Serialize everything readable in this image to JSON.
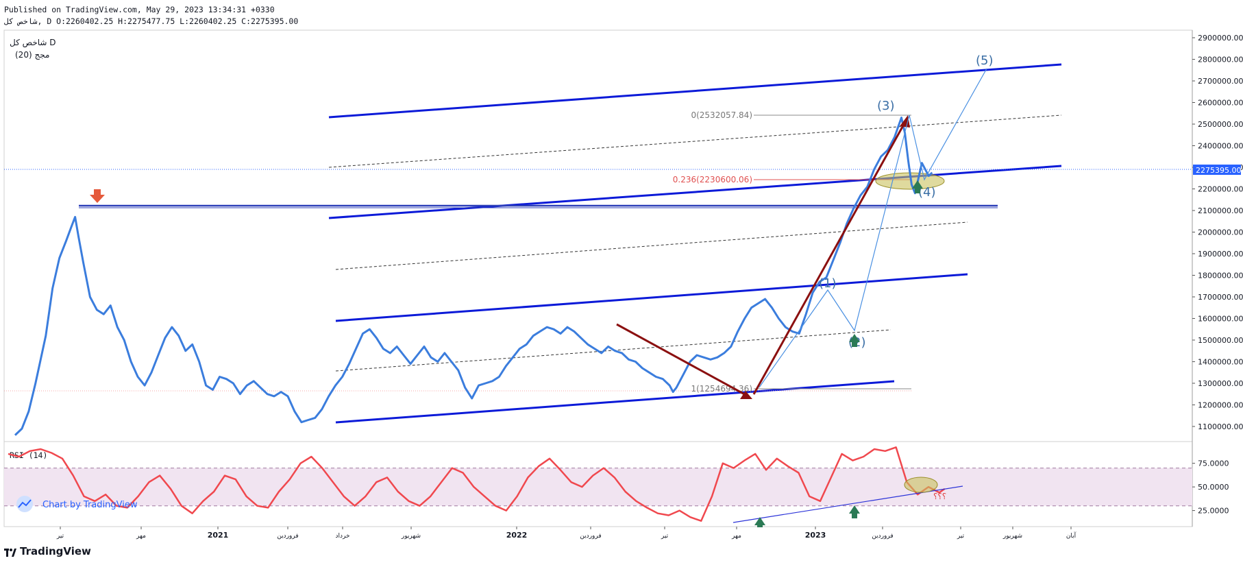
{
  "header": {
    "published": "Published on TradingView.com, May 29, 2023 13:34:31 +0330",
    "ohlc": "ﺷﺎﺧﺺ ﮐﻞ, D O:2260402.25 H:2275477.75 L:2260402.25 C:2275395.00"
  },
  "legend": {
    "symbol": "ﺷﺎﺧﺺ ﮐﻞ D",
    "ma": "(20) ﻣﺠﺞ"
  },
  "footer": {
    "brand": "TradingView",
    "watermark": "Chart by TradingView"
  },
  "colors": {
    "price": "#3b7ddd",
    "channel": "#0b1ad8",
    "rsi": "#f0484e",
    "rsi_band": "#f1e4f1",
    "trend_arrow": "#8b1010",
    "up_arrow": "#2b7a55",
    "down_arrow": "#e55a3c",
    "highlight": "#c9c15e",
    "last_price_tag": "#2962ff"
  },
  "chart_data": [
    {
      "type": "line",
      "title": "",
      "y_ticks": [
        1100000,
        1200000,
        1300000,
        1400000,
        1500000,
        1600000,
        1700000,
        1800000,
        1900000,
        2000000,
        2100000,
        2200000,
        2300000,
        2400000,
        2500000,
        2600000,
        2700000,
        2800000,
        2900000
      ],
      "y_tick_labels": [
        "1100000.00",
        "1200000.00",
        "1300000.00",
        "1400000.00",
        "1500000.00",
        "1600000.00",
        "1700000.00",
        "1800000.00",
        "1900000.00",
        "2000000.00",
        "2100000.00",
        "2200000.00",
        "2300000.00",
        "2400000.00",
        "2500000.00",
        "2600000.00",
        "2700000.00",
        "2800000.00",
        "2900000.00"
      ],
      "ylim": [
        1030000,
        2935000
      ],
      "x_axis_labels": [
        "تیر",
        "مهر",
        "2021",
        "فروردین",
        "خرداد",
        "شهریور",
        "2022",
        "فروردین",
        "تیر",
        "مهر",
        "2023",
        "فروردین",
        "تیر",
        "شهریور",
        "آبان"
      ],
      "last_price": 2275395,
      "last_price_label": "2275395.00",
      "series": [
        {
          "name": "",
          "points": [
            [
              0,
              1060000
            ],
            [
              0.01,
              1090000
            ],
            [
              0.02,
              1170000
            ],
            [
              0.03,
              1300000
            ],
            [
              0.045,
              1520000
            ],
            [
              0.055,
              1740000
            ],
            [
              0.065,
              1880000
            ],
            [
              0.075,
              1960000
            ],
            [
              0.082,
              2020000
            ],
            [
              0.088,
              2070000
            ],
            [
              0.093,
              1980000
            ],
            [
              0.1,
              1860000
            ],
            [
              0.11,
              1700000
            ],
            [
              0.12,
              1640000
            ],
            [
              0.13,
              1620000
            ],
            [
              0.14,
              1660000
            ],
            [
              0.15,
              1560000
            ],
            [
              0.16,
              1500000
            ],
            [
              0.17,
              1400000
            ],
            [
              0.18,
              1330000
            ],
            [
              0.19,
              1290000
            ],
            [
              0.2,
              1350000
            ],
            [
              0.21,
              1430000
            ],
            [
              0.22,
              1510000
            ],
            [
              0.23,
              1560000
            ],
            [
              0.24,
              1520000
            ],
            [
              0.25,
              1450000
            ],
            [
              0.26,
              1480000
            ],
            [
              0.27,
              1400000
            ],
            [
              0.28,
              1290000
            ],
            [
              0.29,
              1270000
            ],
            [
              0.3,
              1330000
            ],
            [
              0.31,
              1320000
            ],
            [
              0.32,
              1300000
            ],
            [
              0.33,
              1250000
            ],
            [
              0.34,
              1290000
            ],
            [
              0.35,
              1310000
            ],
            [
              0.36,
              1280000
            ],
            [
              0.37,
              1250000
            ],
            [
              0.38,
              1240000
            ],
            [
              0.39,
              1260000
            ],
            [
              0.4,
              1240000
            ],
            [
              0.41,
              1170000
            ],
            [
              0.42,
              1120000
            ],
            [
              0.43,
              1130000
            ],
            [
              0.44,
              1140000
            ],
            [
              0.45,
              1180000
            ],
            [
              0.46,
              1240000
            ],
            [
              0.47,
              1290000
            ],
            [
              0.48,
              1330000
            ],
            [
              0.49,
              1390000
            ],
            [
              0.5,
              1460000
            ],
            [
              0.51,
              1530000
            ],
            [
              0.52,
              1550000
            ],
            [
              0.53,
              1510000
            ],
            [
              0.54,
              1460000
            ],
            [
              0.55,
              1440000
            ],
            [
              0.56,
              1470000
            ],
            [
              0.57,
              1430000
            ],
            [
              0.58,
              1390000
            ],
            [
              0.59,
              1430000
            ],
            [
              0.6,
              1470000
            ],
            [
              0.61,
              1420000
            ],
            [
              0.62,
              1400000
            ],
            [
              0.63,
              1440000
            ],
            [
              0.64,
              1400000
            ],
            [
              0.65,
              1360000
            ],
            [
              0.66,
              1280000
            ],
            [
              0.67,
              1230000
            ],
            [
              0.68,
              1290000
            ],
            [
              0.69,
              1300000
            ],
            [
              0.7,
              1310000
            ],
            [
              0.71,
              1330000
            ],
            [
              0.72,
              1380000
            ],
            [
              0.73,
              1420000
            ],
            [
              0.74,
              1460000
            ],
            [
              0.75,
              1480000
            ],
            [
              0.76,
              1520000
            ],
            [
              0.77,
              1540000
            ],
            [
              0.78,
              1560000
            ],
            [
              0.79,
              1550000
            ],
            [
              0.8,
              1530000
            ],
            [
              0.81,
              1560000
            ],
            [
              0.82,
              1540000
            ],
            [
              0.83,
              1510000
            ],
            [
              0.84,
              1480000
            ],
            [
              0.85,
              1460000
            ],
            [
              0.86,
              1440000
            ],
            [
              0.87,
              1470000
            ],
            [
              0.88,
              1450000
            ],
            [
              0.89,
              1440000
            ],
            [
              0.9,
              1410000
            ],
            [
              0.91,
              1400000
            ],
            [
              0.92,
              1370000
            ],
            [
              0.93,
              1350000
            ],
            [
              0.94,
              1330000
            ],
            [
              0.95,
              1320000
            ],
            [
              0.96,
              1290000
            ],
            [
              0.965,
              1260000
            ],
            [
              0.97,
              1280000
            ],
            [
              0.98,
              1340000
            ],
            [
              0.99,
              1400000
            ],
            [
              1.0,
              1430000
            ],
            [
              1.01,
              1420000
            ],
            [
              1.02,
              1410000
            ],
            [
              1.03,
              1420000
            ],
            [
              1.04,
              1440000
            ],
            [
              1.05,
              1470000
            ],
            [
              1.06,
              1540000
            ],
            [
              1.07,
              1600000
            ],
            [
              1.08,
              1650000
            ],
            [
              1.09,
              1670000
            ],
            [
              1.1,
              1690000
            ],
            [
              1.11,
              1650000
            ],
            [
              1.12,
              1600000
            ],
            [
              1.13,
              1560000
            ],
            [
              1.14,
              1540000
            ],
            [
              1.15,
              1530000
            ],
            [
              1.16,
              1620000
            ],
            [
              1.17,
              1720000
            ],
            [
              1.18,
              1770000
            ],
            [
              1.19,
              1790000
            ],
            [
              1.2,
              1870000
            ],
            [
              1.21,
              1950000
            ],
            [
              1.22,
              2040000
            ],
            [
              1.23,
              2110000
            ],
            [
              1.24,
              2170000
            ],
            [
              1.25,
              2210000
            ],
            [
              1.26,
              2290000
            ],
            [
              1.27,
              2350000
            ],
            [
              1.28,
              2380000
            ],
            [
              1.29,
              2440000
            ],
            [
              1.3,
              2530000
            ],
            [
              1.305,
              2460000
            ],
            [
              1.31,
              2330000
            ],
            [
              1.315,
              2220000
            ],
            [
              1.32,
              2180000
            ],
            [
              1.325,
              2250000
            ],
            [
              1.33,
              2320000
            ],
            [
              1.335,
              2290000
            ],
            [
              1.34,
              2260000
            ],
            [
              1.345,
              2275395
            ]
          ]
        }
      ],
      "annotations": {
        "wave_labels": [
          "(1)",
          "(2)",
          "(3)",
          "(4)",
          "(5)"
        ],
        "fib_levels": [
          {
            "label": "0(2532057.84)",
            "value": 2532057.84
          },
          {
            "label": "0.236(2230600.06)",
            "value": 2230600.06
          },
          {
            "label": "1(1254694.36)",
            "value": 1254694.36
          }
        ]
      }
    },
    {
      "type": "line",
      "title": "RSI (14)",
      "y_ticks": [
        25,
        50,
        75
      ],
      "y_tick_labels": [
        "25.0000",
        "50.0000",
        "75.0000"
      ],
      "ylim": [
        8,
        98
      ],
      "band": [
        30,
        70
      ],
      "question_marks": "؟؟؟",
      "series": [
        {
          "name": "",
          "points": [
            [
              0.0,
              85
            ],
            [
              0.02,
              82
            ],
            [
              0.04,
              88
            ],
            [
              0.06,
              90
            ],
            [
              0.08,
              86
            ],
            [
              0.1,
              80
            ],
            [
              0.12,
              62
            ],
            [
              0.14,
              40
            ],
            [
              0.16,
              35
            ],
            [
              0.18,
              42
            ],
            [
              0.2,
              30
            ],
            [
              0.22,
              28
            ],
            [
              0.24,
              40
            ],
            [
              0.26,
              55
            ],
            [
              0.28,
              62
            ],
            [
              0.3,
              48
            ],
            [
              0.32,
              30
            ],
            [
              0.34,
              22
            ],
            [
              0.36,
              35
            ],
            [
              0.38,
              45
            ],
            [
              0.4,
              62
            ],
            [
              0.42,
              58
            ],
            [
              0.44,
              40
            ],
            [
              0.46,
              30
            ],
            [
              0.48,
              28
            ],
            [
              0.5,
              45
            ],
            [
              0.52,
              58
            ],
            [
              0.54,
              75
            ],
            [
              0.56,
              82
            ],
            [
              0.58,
              70
            ],
            [
              0.6,
              55
            ],
            [
              0.62,
              40
            ],
            [
              0.64,
              30
            ],
            [
              0.66,
              40
            ],
            [
              0.68,
              55
            ],
            [
              0.7,
              60
            ],
            [
              0.72,
              45
            ],
            [
              0.74,
              35
            ],
            [
              0.76,
              30
            ],
            [
              0.78,
              40
            ],
            [
              0.8,
              55
            ],
            [
              0.82,
              70
            ],
            [
              0.84,
              65
            ],
            [
              0.86,
              50
            ],
            [
              0.88,
              40
            ],
            [
              0.9,
              30
            ],
            [
              0.92,
              25
            ],
            [
              0.94,
              40
            ],
            [
              0.96,
              60
            ],
            [
              0.98,
              72
            ],
            [
              1.0,
              80
            ],
            [
              1.02,
              68
            ],
            [
              1.04,
              55
            ],
            [
              1.06,
              50
            ],
            [
              1.08,
              62
            ],
            [
              1.1,
              70
            ],
            [
              1.12,
              60
            ],
            [
              1.14,
              45
            ],
            [
              1.16,
              35
            ],
            [
              1.18,
              28
            ],
            [
              1.2,
              22
            ],
            [
              1.22,
              20
            ],
            [
              1.24,
              25
            ],
            [
              1.26,
              18
            ],
            [
              1.28,
              14
            ],
            [
              1.3,
              40
            ],
            [
              1.32,
              75
            ],
            [
              1.34,
              70
            ],
            [
              1.36,
              78
            ],
            [
              1.38,
              85
            ],
            [
              1.4,
              68
            ],
            [
              1.42,
              80
            ],
            [
              1.44,
              72
            ],
            [
              1.46,
              65
            ],
            [
              1.48,
              40
            ],
            [
              1.5,
              35
            ],
            [
              1.52,
              60
            ],
            [
              1.54,
              85
            ],
            [
              1.56,
              78
            ],
            [
              1.58,
              82
            ],
            [
              1.6,
              90
            ],
            [
              1.62,
              88
            ],
            [
              1.64,
              92
            ],
            [
              1.66,
              55
            ],
            [
              1.68,
              42
            ],
            [
              1.7,
              50
            ],
            [
              1.72,
              44
            ],
            [
              1.73,
              48
            ]
          ]
        }
      ]
    }
  ]
}
